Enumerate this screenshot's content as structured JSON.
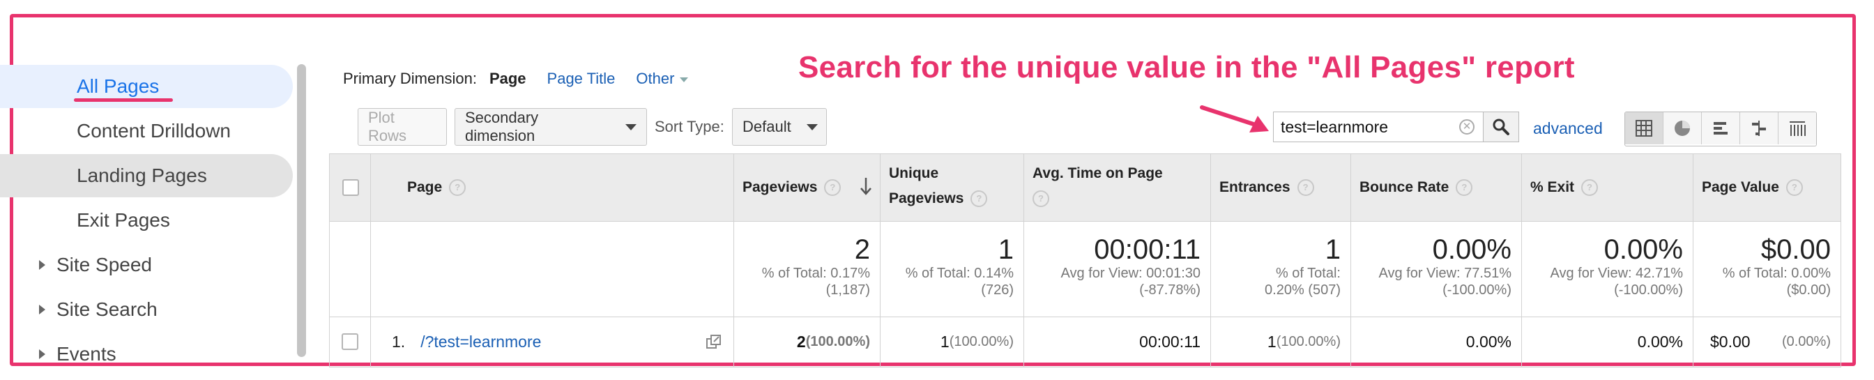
{
  "sidebar": {
    "items": [
      {
        "label": "All Pages"
      },
      {
        "label": "Content Drilldown"
      },
      {
        "label": "Landing Pages"
      },
      {
        "label": "Exit Pages"
      },
      {
        "label": "Site Speed"
      },
      {
        "label": "Site Search"
      },
      {
        "label": "Events"
      }
    ]
  },
  "dimension_bar": {
    "label": "Primary Dimension:",
    "current": "Page",
    "page_title": "Page Title",
    "other": "Other"
  },
  "annotation": "Search for the unique value in the \"All Pages\" report",
  "toolbar": {
    "plot_rows": "Plot Rows",
    "secondary_dimension": "Secondary dimension",
    "sort_type_label": "Sort Type:",
    "sort_type_value": "Default",
    "search_value": "test=learnmore",
    "advanced": "advanced"
  },
  "table": {
    "columns": {
      "page": "Page",
      "pageviews": "Pageviews",
      "unique_pageviews_1": "Unique",
      "unique_pageviews_2": "Pageviews",
      "avg_time": "Avg. Time on Page",
      "entrances": "Entrances",
      "bounce_rate": "Bounce Rate",
      "exit": "% Exit",
      "page_value": "Page Value"
    },
    "totals": {
      "pageviews": {
        "value": "2",
        "sub1": "% of Total: 0.17%",
        "sub2": "(1,187)"
      },
      "unique_pageviews": {
        "value": "1",
        "sub1": "% of Total: 0.14%",
        "sub2": "(726)"
      },
      "avg_time": {
        "value": "00:00:11",
        "sub1": "Avg for View: 00:01:30",
        "sub2": "(-87.78%)"
      },
      "entrances": {
        "value": "1",
        "sub1": "% of Total:",
        "sub2": "0.20% (507)"
      },
      "bounce_rate": {
        "value": "0.00%",
        "sub1": "Avg for View: 77.51%",
        "sub2": "(-100.00%)"
      },
      "exit": {
        "value": "0.00%",
        "sub1": "Avg for View: 42.71%",
        "sub2": "(-100.00%)"
      },
      "page_value": {
        "value": "$0.00",
        "sub1": "% of Total: 0.00%",
        "sub2": "($0.00)"
      }
    },
    "rows": [
      {
        "index": "1.",
        "page": "/?test=learnmore",
        "pageviews": "2",
        "pageviews_pct": "(100.00%)",
        "unique_pageviews": "1",
        "unique_pageviews_pct": "(100.00%)",
        "avg_time": "00:00:11",
        "entrances": "1",
        "entrances_pct": "(100.00%)",
        "bounce_rate": "0.00%",
        "exit": "0.00%",
        "page_value": "$0.00",
        "page_value_pct": "(0.00%)"
      }
    ]
  },
  "colors": {
    "annotation": "#e8336d",
    "link": "#1a5fb4",
    "active_bg": "#e8f0fe"
  }
}
